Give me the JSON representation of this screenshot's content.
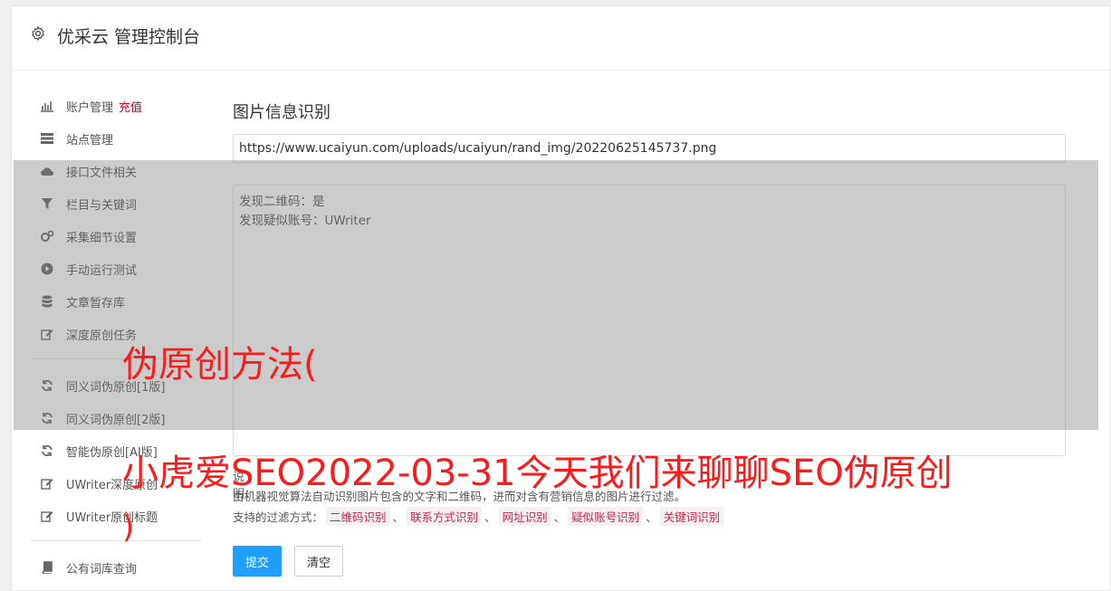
{
  "header": {
    "title": "优采云 管理控制台"
  },
  "sidebar": {
    "items": [
      {
        "label": "账户管理",
        "extra": "充值",
        "icon": "bar-chart-icon"
      },
      {
        "label": "站点管理",
        "icon": "server-icon"
      },
      {
        "label": "接口文件相关",
        "icon": "cloud-upload-icon"
      },
      {
        "label": "栏目与关键词",
        "icon": "filter-icon"
      },
      {
        "label": "采集细节设置",
        "icon": "cogs-icon"
      },
      {
        "label": "手动运行测试",
        "icon": "play-circle-icon"
      },
      {
        "label": "文章暂存库",
        "icon": "database-icon"
      },
      {
        "label": "深度原创任务",
        "icon": "edit-icon"
      },
      {
        "label": "同义词伪原创[1版]",
        "icon": "refresh-icon"
      },
      {
        "label": "同义词伪原创[2版]",
        "icon": "refresh-icon"
      },
      {
        "label": "智能伪原创[AI版]",
        "icon": "refresh-icon"
      },
      {
        "label": "UWriter深度原创",
        "icon": "edit-icon"
      },
      {
        "label": "UWriter原创标题",
        "icon": "edit-icon"
      },
      {
        "label": "公有词库查询",
        "icon": "book-icon"
      }
    ]
  },
  "main": {
    "section_title": "图片信息识别",
    "url_value": "https://www.ucaiyun.com/uploads/ucaiyun/rand_img/20220625145737.png",
    "result_lines": [
      "发现二维码：是",
      "发现疑似账号：UWriter"
    ],
    "note_label": "说明：",
    "note_text": "由机器视觉算法自动识别图片包含的文字和二维码，进而对含有营销信息的图片进行过滤。",
    "filter_prefix": "支持的过滤方式：",
    "filter_tags": [
      "二维码识别",
      "联系方式识别",
      "网址识别",
      "疑似账号识别",
      "关键词识别"
    ],
    "filter_sep": "、",
    "submit_label": "提交",
    "clear_label": "清空"
  },
  "watermark": {
    "line1": "伪原创方法(",
    "line2": "小虎爱SEO2022-03-31今天我们来聊聊SEO伪原创",
    "line3": ")"
  },
  "colors": {
    "accent": "#1e9fff",
    "recharge": "#d9001b",
    "watermark": "#ff1a1a",
    "tag_text": "#c7254e"
  }
}
